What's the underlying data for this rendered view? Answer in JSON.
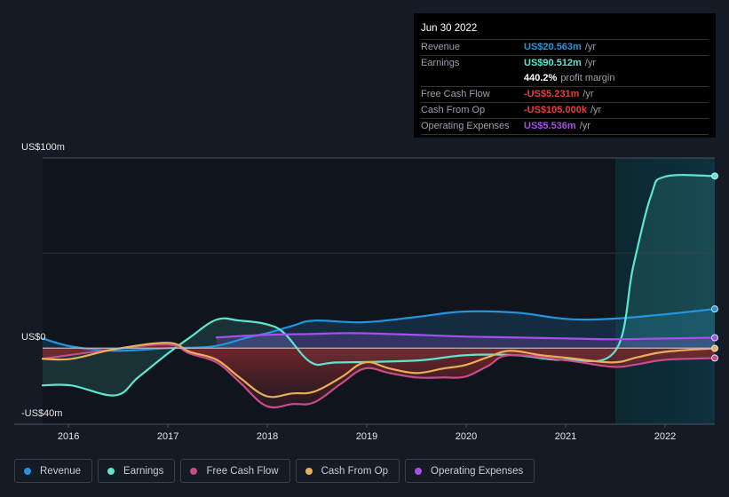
{
  "tooltip": {
    "date": "Jun 30 2022",
    "rows": [
      {
        "label": "Revenue",
        "value": "US$20.563m",
        "unit": "/yr",
        "color": "#2394df"
      },
      {
        "label": "Earnings",
        "value": "US$90.512m",
        "unit": "/yr",
        "color": "#5ee5d0"
      },
      {
        "label": "",
        "value": "440.2%",
        "unit": "profit margin",
        "color": "#ffffff"
      },
      {
        "label": "Free Cash Flow",
        "value": "-US$5.231m",
        "unit": "/yr",
        "color": "#e63f3f"
      },
      {
        "label": "Cash From Op",
        "value": "-US$105.000k",
        "unit": "/yr",
        "color": "#e63f3f"
      },
      {
        "label": "Operating Expenses",
        "value": "US$5.536m",
        "unit": "/yr",
        "color": "#a550e8"
      }
    ]
  },
  "legend": [
    {
      "label": "Revenue",
      "color": "#2394df"
    },
    {
      "label": "Earnings",
      "color": "#5ee5d0"
    },
    {
      "label": "Free Cash Flow",
      "color": "#c84b8b"
    },
    {
      "label": "Cash From Op",
      "color": "#e8ae5a"
    },
    {
      "label": "Operating Expenses",
      "color": "#a550e8"
    }
  ],
  "chart_data": {
    "type": "line",
    "title": "",
    "xlabel": "",
    "ylabel": "",
    "y_tick_labels": [
      "US$100m",
      "US$0",
      "-US$40m"
    ],
    "x_tick_labels": [
      "2016",
      "2017",
      "2018",
      "2019",
      "2020",
      "2021",
      "2022"
    ],
    "xlim": [
      2015.74,
      2022.5
    ],
    "ylim": [
      -40,
      100
    ],
    "highlight_range": [
      2021.5,
      2022.5
    ],
    "units": "US$ millions",
    "series": [
      {
        "name": "Revenue",
        "color": "#2394df",
        "x": [
          2015.74,
          2016.03,
          2016.47,
          2017.0,
          2017.45,
          2017.8,
          2018.0,
          2018.25,
          2018.47,
          2018.96,
          2019.5,
          2019.96,
          2020.5,
          2021.0,
          2021.45,
          2022.0,
          2022.5
        ],
        "y": [
          5.1,
          0.9,
          -1.4,
          0.0,
          0.9,
          5.6,
          7.9,
          11.7,
          14.5,
          13.6,
          16.4,
          19.2,
          18.7,
          15.4,
          15.4,
          17.8,
          20.6
        ]
      },
      {
        "name": "Earnings",
        "color": "#5ee5d0",
        "x": [
          2015.74,
          2016.03,
          2016.47,
          2016.7,
          2017.0,
          2017.22,
          2017.49,
          2017.72,
          2017.99,
          2018.17,
          2018.44,
          2018.71,
          2019.5,
          2019.99,
          2020.5,
          2021.0,
          2021.5,
          2021.68,
          2021.86,
          2022.0,
          2022.5
        ],
        "y": [
          -19.6,
          -19.6,
          -24.8,
          -15.4,
          -2.8,
          5.6,
          15.0,
          14.5,
          12.6,
          7.9,
          -7.5,
          -7.5,
          -6.5,
          -3.7,
          -3.7,
          -6.1,
          -1.4,
          43.0,
          80.4,
          90.2,
          90.5
        ]
      },
      {
        "name": "Free Cash Flow",
        "color": "#c84b8b",
        "x": [
          2015.74,
          2016.47,
          2017.0,
          2017.22,
          2017.49,
          2017.72,
          2017.99,
          2018.25,
          2018.47,
          2018.74,
          2018.98,
          2019.23,
          2019.5,
          2019.77,
          2019.99,
          2020.22,
          2020.44,
          2021.02,
          2021.47,
          2021.73,
          2022.0,
          2022.5
        ],
        "y": [
          -5.6,
          -0.5,
          1.9,
          -2.8,
          -7.5,
          -17.8,
          -30.4,
          -29.4,
          -28.5,
          -18.7,
          -10.7,
          -13.1,
          -15.4,
          -15.4,
          -15.0,
          -9.3,
          -3.7,
          -6.5,
          -9.8,
          -8.4,
          -6.1,
          -5.2
        ]
      },
      {
        "name": "Cash From Op",
        "color": "#e8ae5a",
        "x": [
          2015.74,
          2016.03,
          2016.47,
          2017.0,
          2017.22,
          2017.49,
          2017.72,
          2017.99,
          2018.25,
          2018.47,
          2018.74,
          2018.98,
          2019.23,
          2019.5,
          2019.77,
          2019.99,
          2020.22,
          2020.44,
          2020.75,
          2021.02,
          2021.47,
          2021.73,
          2022.0,
          2022.5
        ],
        "y": [
          -5.6,
          -5.6,
          -0.5,
          2.8,
          -1.9,
          -6.1,
          -15.4,
          -25.2,
          -23.8,
          -22.9,
          -15.4,
          -7.5,
          -10.7,
          -13.1,
          -10.7,
          -8.9,
          -4.7,
          -1.4,
          -3.7,
          -5.1,
          -7.5,
          -4.7,
          -1.9,
          -0.1
        ]
      },
      {
        "name": "Operating Expenses",
        "color": "#a550e8",
        "x": [
          2017.49,
          2017.99,
          2018.47,
          2018.87,
          2019.5,
          2019.99,
          2020.5,
          2021.02,
          2021.47,
          2022.0,
          2022.5
        ],
        "y": [
          5.6,
          7.0,
          7.5,
          7.9,
          7.0,
          6.1,
          5.6,
          5.1,
          4.7,
          5.1,
          5.5
        ]
      }
    ]
  }
}
